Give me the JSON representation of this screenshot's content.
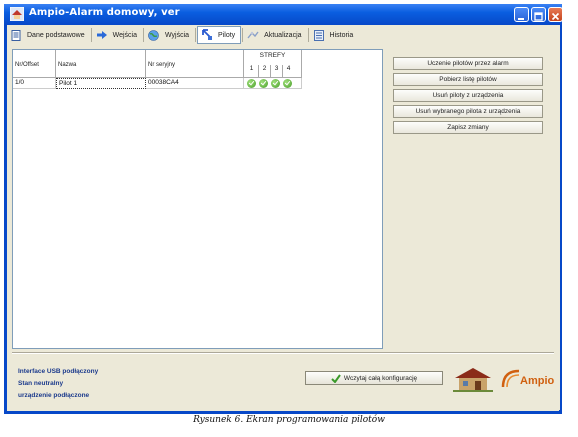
{
  "window": {
    "title": "Ampio-Alarm domowy, ver"
  },
  "toolbar": {
    "tabs": [
      {
        "label": "Dane podstawowe",
        "icon": "document-icon"
      },
      {
        "label": "Wejścia",
        "icon": "arrow-right-icon"
      },
      {
        "label": "Wyjścia",
        "icon": "globe-icon"
      },
      {
        "label": "Piloty",
        "icon": "remote-icon",
        "active": true
      },
      {
        "label": "Aktualizacja",
        "icon": "update-icon"
      },
      {
        "label": "Historia",
        "icon": "history-icon"
      }
    ]
  },
  "grid": {
    "columns": {
      "nr_offset": "Nr/Offset",
      "name": "Nazwa",
      "serial": "Nr seryjny",
      "zones": "STREFY"
    },
    "zone_numbers": [
      "1",
      "2",
      "3",
      "4"
    ],
    "rows": [
      {
        "nr_offset": "1/0",
        "name": "Pilot 1",
        "serial": "00038CA4",
        "zones": [
          true,
          true,
          true,
          true
        ]
      }
    ]
  },
  "actions": {
    "learn": "Uczenie pilotów przez alarm",
    "get_list": "Pobierz listę pilotów",
    "remove_all": "Usuń piloty z urządzenia",
    "remove_selected": "Usuń wybranego pilota z urządzenia",
    "save": "Zapisz zmiany"
  },
  "status": {
    "line1": "Interface USB podłączony",
    "line2": "Stan neutralny",
    "line3": "urządzenie podłączone"
  },
  "send_button": "Wczytaj całą konfigurację",
  "logo": {
    "text": "Ampio"
  },
  "caption": "Rysunek 6. Ekran programowania pilotów",
  "colors": {
    "titlebar": "#0a5ee0",
    "status_text": "#1b3a8c",
    "check": "#4a9e2a",
    "logo": "#d06010"
  }
}
